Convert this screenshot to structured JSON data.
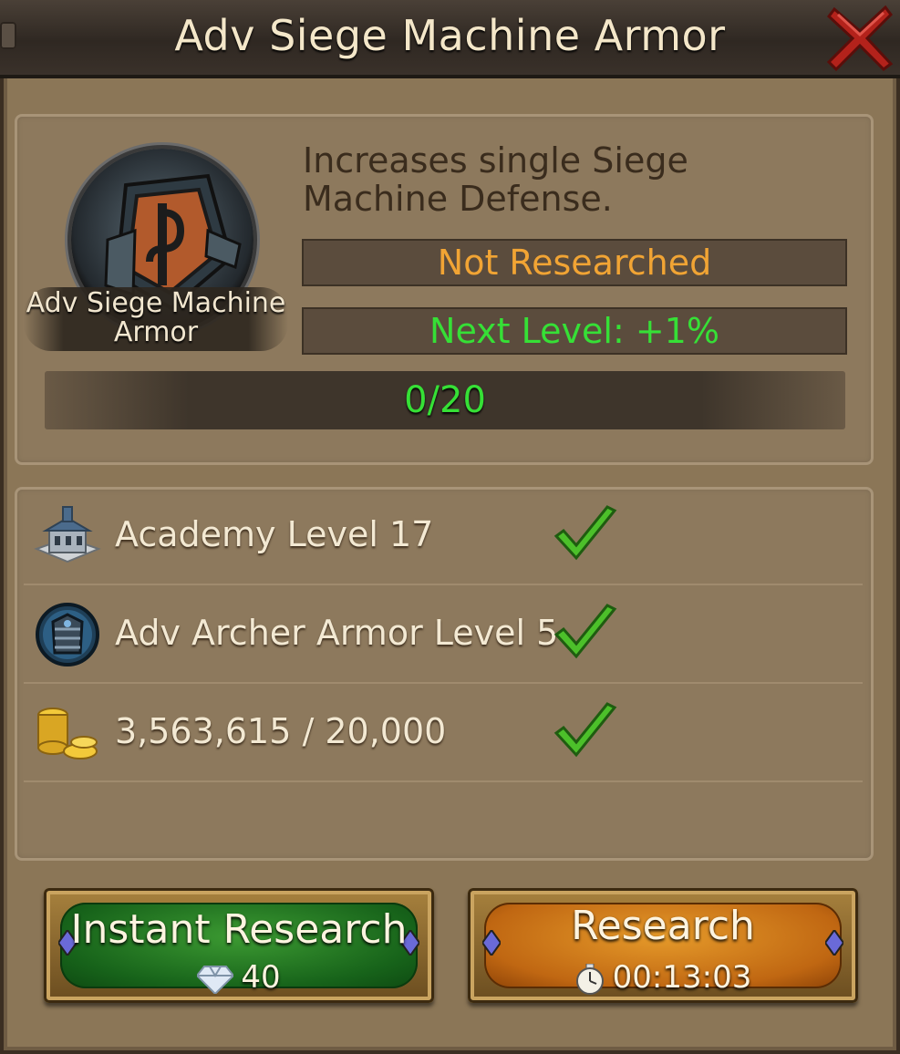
{
  "window": {
    "title": "Adv Siege Machine Armor"
  },
  "research": {
    "name": "Adv Siege Machine Armor",
    "description": "Increases single Siege Machine Defense.",
    "status": "Not Researched",
    "next_level": "Next Level: +1%",
    "progress_text": "0/20",
    "progress_fraction": 0
  },
  "requirements": [
    {
      "icon": "academy-building-icon",
      "text": "Academy Level 17",
      "met": true
    },
    {
      "icon": "archer-armor-icon",
      "text": "Adv Archer Armor Level 5",
      "met": true
    },
    {
      "icon": "gold-coins-icon",
      "text": "3,563,615 / 20,000",
      "met": true
    }
  ],
  "actions": {
    "instant_label": "Instant Research",
    "instant_cost": "40",
    "instant_cost_icon": "gem-icon",
    "research_label": "Research",
    "research_time": "00:13:03",
    "research_time_icon": "stopwatch-icon"
  },
  "colors": {
    "status_orange": "#f1a434",
    "bonus_green": "#36e036",
    "check_green": "#4cc02a"
  }
}
